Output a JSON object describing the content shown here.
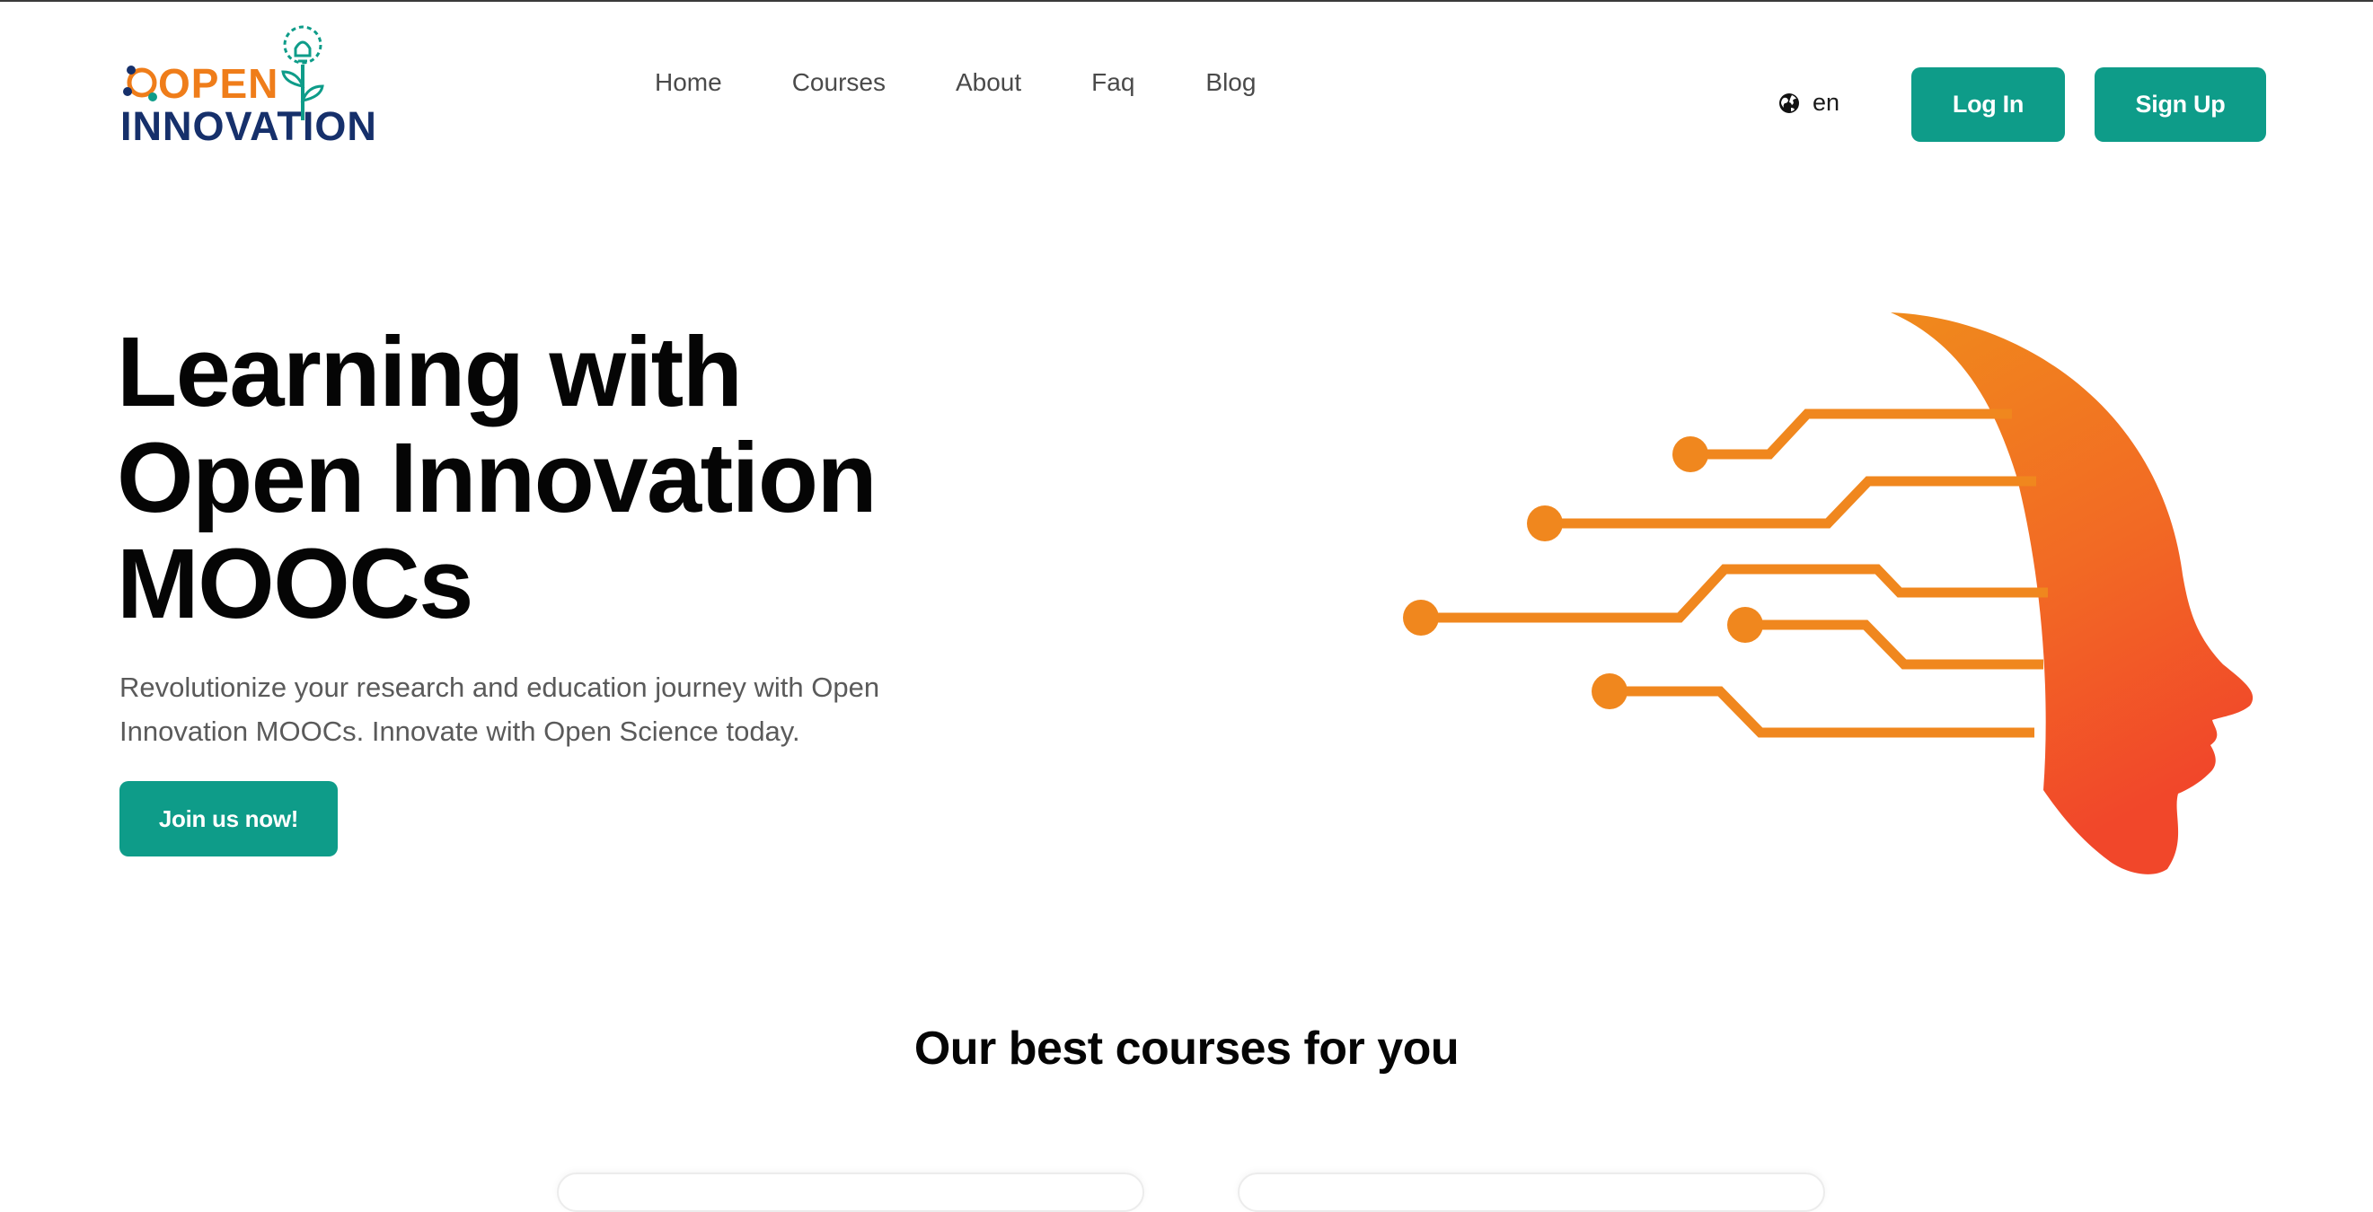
{
  "brand": {
    "logo_top": "OPEN",
    "logo_bottom": "INNOVATION",
    "colors": {
      "accent": "#0e9c89",
      "orange": "#ef7d1a",
      "navy": "#16306b"
    }
  },
  "nav": {
    "items": [
      {
        "label": "Home"
      },
      {
        "label": "Courses"
      },
      {
        "label": "About"
      },
      {
        "label": "Faq"
      },
      {
        "label": "Blog"
      }
    ]
  },
  "header": {
    "language": {
      "icon": "globe-icon",
      "value": "en"
    },
    "login_label": "Log In",
    "signup_label": "Sign Up"
  },
  "hero": {
    "title_lines": [
      "Learning with",
      "Open Innovation",
      "MOOCs"
    ],
    "subtitle_lines": [
      "Revolutionize your research and education journey with Open",
      "Innovation MOOCs. Innovate with Open Science today."
    ],
    "cta_label": "Join us now!",
    "illustration": "orange-head-circuit-illustration"
  },
  "courses_section": {
    "title": "Our best courses for you"
  }
}
